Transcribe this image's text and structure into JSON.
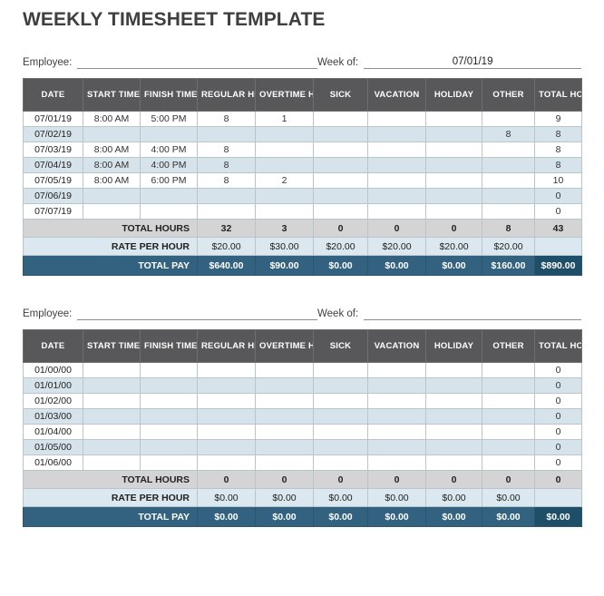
{
  "document": {
    "title": "WEEKLY TIMESHEET TEMPLATE"
  },
  "columns": [
    {
      "id": "date",
      "label": "DATE"
    },
    {
      "id": "start",
      "label": "START TIME"
    },
    {
      "id": "finish",
      "label": "FINISH TIME"
    },
    {
      "id": "regular",
      "label": "REGULAR HRS"
    },
    {
      "id": "overtime",
      "label": "OVERTIME HRS"
    },
    {
      "id": "sick",
      "label": "SICK"
    },
    {
      "id": "vacation",
      "label": "VACATION"
    },
    {
      "id": "holiday",
      "label": "HOLIDAY"
    },
    {
      "id": "other",
      "label": "OTHER"
    },
    {
      "id": "total",
      "label": "TOTAL HOURS"
    }
  ],
  "summary_labels": {
    "total_hours": "TOTAL HOURS",
    "rate_per_hour": "RATE PER HOUR",
    "total_pay": "TOTAL PAY"
  },
  "tables": [
    {
      "meta": {
        "employee_label": "Employee:",
        "employee_value": "",
        "weekof_label": "Week of:",
        "weekof_value": "07/01/19"
      },
      "rows": [
        {
          "date": "07/01/19",
          "start": "8:00 AM",
          "finish": "5:00 PM",
          "regular": "8",
          "overtime": "1",
          "sick": "",
          "vacation": "",
          "holiday": "",
          "other": "",
          "total": "9"
        },
        {
          "date": "07/02/19",
          "start": "",
          "finish": "",
          "regular": "",
          "overtime": "",
          "sick": "",
          "vacation": "",
          "holiday": "",
          "other": "8",
          "total": "8"
        },
        {
          "date": "07/03/19",
          "start": "8:00 AM",
          "finish": "4:00 PM",
          "regular": "8",
          "overtime": "",
          "sick": "",
          "vacation": "",
          "holiday": "",
          "other": "",
          "total": "8"
        },
        {
          "date": "07/04/19",
          "start": "8:00 AM",
          "finish": "4:00 PM",
          "regular": "8",
          "overtime": "",
          "sick": "",
          "vacation": "",
          "holiday": "",
          "other": "",
          "total": "8"
        },
        {
          "date": "07/05/19",
          "start": "8:00 AM",
          "finish": "6:00 PM",
          "regular": "8",
          "overtime": "2",
          "sick": "",
          "vacation": "",
          "holiday": "",
          "other": "",
          "total": "10"
        },
        {
          "date": "07/06/19",
          "start": "",
          "finish": "",
          "regular": "",
          "overtime": "",
          "sick": "",
          "vacation": "",
          "holiday": "",
          "other": "",
          "total": "0"
        },
        {
          "date": "07/07/19",
          "start": "",
          "finish": "",
          "regular": "",
          "overtime": "",
          "sick": "",
          "vacation": "",
          "holiday": "",
          "other": "",
          "total": "0"
        }
      ],
      "total_hours": {
        "regular": "32",
        "overtime": "3",
        "sick": "0",
        "vacation": "0",
        "holiday": "0",
        "other": "8",
        "total": "43"
      },
      "rate_per_hour": {
        "regular": "$20.00",
        "overtime": "$30.00",
        "sick": "$20.00",
        "vacation": "$20.00",
        "holiday": "$20.00",
        "other": "$20.00",
        "total": ""
      },
      "total_pay": {
        "regular": "$640.00",
        "overtime": "$90.00",
        "sick": "$0.00",
        "vacation": "$0.00",
        "holiday": "$0.00",
        "other": "$160.00",
        "total": "$890.00"
      }
    },
    {
      "meta": {
        "employee_label": "Employee:",
        "employee_value": "",
        "weekof_label": "Week of:",
        "weekof_value": ""
      },
      "rows": [
        {
          "date": "01/00/00",
          "start": "",
          "finish": "",
          "regular": "",
          "overtime": "",
          "sick": "",
          "vacation": "",
          "holiday": "",
          "other": "",
          "total": "0"
        },
        {
          "date": "01/01/00",
          "start": "",
          "finish": "",
          "regular": "",
          "overtime": "",
          "sick": "",
          "vacation": "",
          "holiday": "",
          "other": "",
          "total": "0"
        },
        {
          "date": "01/02/00",
          "start": "",
          "finish": "",
          "regular": "",
          "overtime": "",
          "sick": "",
          "vacation": "",
          "holiday": "",
          "other": "",
          "total": "0"
        },
        {
          "date": "01/03/00",
          "start": "",
          "finish": "",
          "regular": "",
          "overtime": "",
          "sick": "",
          "vacation": "",
          "holiday": "",
          "other": "",
          "total": "0"
        },
        {
          "date": "01/04/00",
          "start": "",
          "finish": "",
          "regular": "",
          "overtime": "",
          "sick": "",
          "vacation": "",
          "holiday": "",
          "other": "",
          "total": "0"
        },
        {
          "date": "01/05/00",
          "start": "",
          "finish": "",
          "regular": "",
          "overtime": "",
          "sick": "",
          "vacation": "",
          "holiday": "",
          "other": "",
          "total": "0"
        },
        {
          "date": "01/06/00",
          "start": "",
          "finish": "",
          "regular": "",
          "overtime": "",
          "sick": "",
          "vacation": "",
          "holiday": "",
          "other": "",
          "total": "0"
        }
      ],
      "total_hours": {
        "regular": "0",
        "overtime": "0",
        "sick": "0",
        "vacation": "0",
        "holiday": "0",
        "other": "0",
        "total": "0"
      },
      "rate_per_hour": {
        "regular": "$0.00",
        "overtime": "$0.00",
        "sick": "$0.00",
        "vacation": "$0.00",
        "holiday": "$0.00",
        "other": "$0.00",
        "total": ""
      },
      "total_pay": {
        "regular": "$0.00",
        "overtime": "$0.00",
        "sick": "$0.00",
        "vacation": "$0.00",
        "holiday": "$0.00",
        "other": "$0.00",
        "total": "$0.00"
      }
    }
  ],
  "colors": {
    "header_gray": "#58585a",
    "row_alt_blue": "#d6e3ea",
    "total_hours_gray": "#d4d4d4",
    "rate_blue": "#dbe8ef",
    "total_pay_blue": "#336280",
    "grand_total_blue": "#1f4e68"
  }
}
